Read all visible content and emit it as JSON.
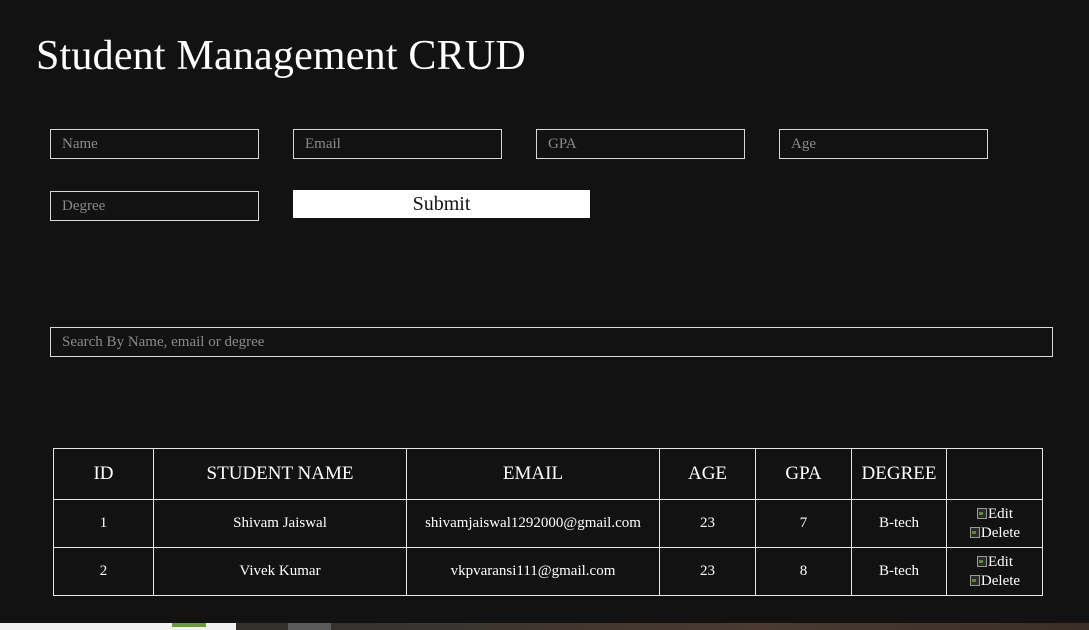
{
  "title": "Student Management CRUD",
  "form": {
    "name_placeholder": "Name",
    "email_placeholder": "Email",
    "gpa_placeholder": "GPA",
    "age_placeholder": "Age",
    "degree_placeholder": "Degree",
    "submit_label": "Submit"
  },
  "search": {
    "placeholder": "Search By Name, email or degree"
  },
  "table": {
    "headers": [
      "ID",
      "STUDENT NAME",
      "EMAIL",
      "AGE",
      "GPA",
      "DEGREE",
      ""
    ],
    "rows": [
      {
        "id": "1",
        "name": "Shivam Jaiswal",
        "email": "shivamjaiswal1292000@gmail.com",
        "age": "23",
        "gpa": "7",
        "degree": "B-tech",
        "edit": "Edit",
        "delete": "Delete"
      },
      {
        "id": "2",
        "name": "Vivek Kumar",
        "email": "vkpvaransi111@gmail.com",
        "age": "23",
        "gpa": "8",
        "degree": "B-tech",
        "edit": "Edit",
        "delete": "Delete"
      }
    ]
  },
  "icons": {
    "edit": "broken-image-icon",
    "delete": "broken-image-icon"
  },
  "colors": {
    "background": "#121212",
    "text": "#ffffff",
    "border": "#d8d8d8",
    "placeholder": "#8a8a8a",
    "button_bg": "#ffffff",
    "button_text": "#111111"
  }
}
